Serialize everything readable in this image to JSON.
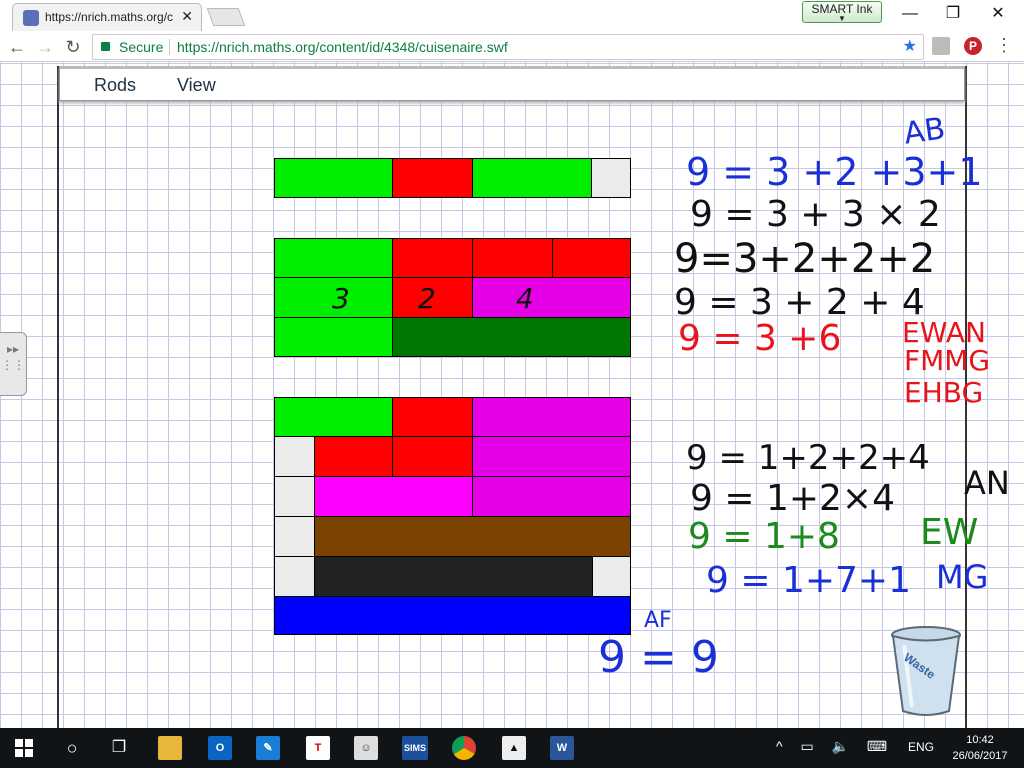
{
  "browser": {
    "tab_title": "https://nrich.maths.org/c",
    "tab_close": "✕",
    "smart_ink": "SMART Ink",
    "secure_label": "Secure",
    "url": "https://nrich.maths.org/content/id/4348/cuisenaire.swf",
    "minimize": "—",
    "restore": "❐",
    "close": "✕",
    "back": "←",
    "forward": "→",
    "reload": "↻",
    "star": "★"
  },
  "flash_menu": {
    "rods": "Rods",
    "view": "View"
  },
  "rod_colors": {
    "white": "#ebebeb",
    "red": "#ff0000",
    "light_green": "#00ee00",
    "pink": "#e600e6",
    "dark_green": "#007700",
    "brown": "#7a4400",
    "black": "#222222",
    "blue": "#0000ff",
    "magenta": "#ff00ff"
  },
  "rod_labels": {
    "three": "3",
    "two": "2",
    "four": "4"
  },
  "handwriting": {
    "initials_ab": "AB",
    "eq1": "9 = 3 +2 +3+1",
    "eq2": "9 = 3 + 3 × 2",
    "eq3": "9=3+2+2+2",
    "eq4": "9 = 3 + 2 + 4",
    "eq5": "9 = 3 +6",
    "initials_red1": "EWAN",
    "initials_red2": "FMMG",
    "initials_red3": "EHBG",
    "eq6": "9 = 1+2+2+4",
    "eq7": "9 = 1+2×4",
    "initials_an": "AN",
    "eq8": "9 = 1+8",
    "initials_ew": "EW",
    "eq9": "9 = 1+7+1",
    "initials_mg": "MG",
    "initials_af": "AF",
    "eq10": "9 = 9"
  },
  "ink_colors": {
    "blue": "#1a2fd6",
    "black": "#111111",
    "red": "#e8141c",
    "green": "#1c8a1c"
  },
  "waste_bin": {
    "label": "Waste"
  },
  "taskbar": {
    "sims": "SIMS",
    "lang": "ENG",
    "time": "10:42",
    "date": "26/06/2017"
  }
}
